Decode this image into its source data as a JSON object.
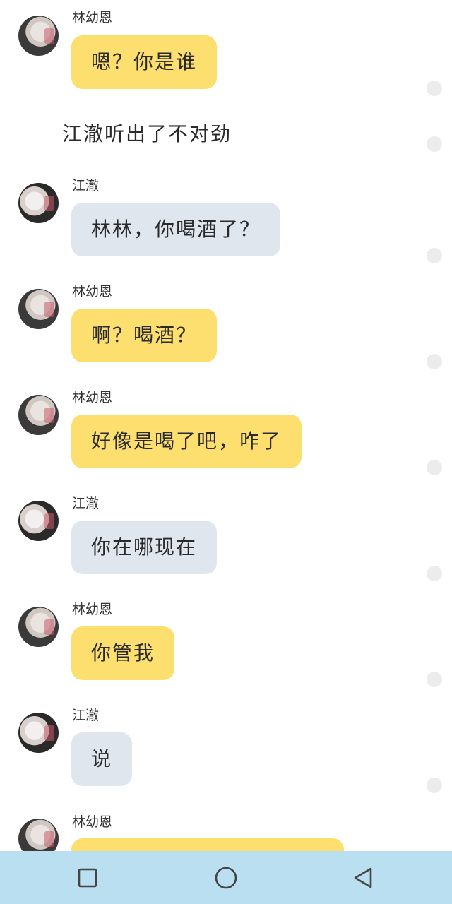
{
  "chat": {
    "narration": "江澈听出了不对劲",
    "messages": [
      {
        "sender": "林幼恩",
        "text": "嗯？你是谁",
        "style": "yellow"
      },
      {
        "sender": "江澈",
        "text": "林林，你喝酒了？",
        "style": "grey"
      },
      {
        "sender": "林幼恩",
        "text": "啊？喝酒？",
        "style": "yellow"
      },
      {
        "sender": "林幼恩",
        "text": "好像是喝了吧，咋了",
        "style": "yellow"
      },
      {
        "sender": "江澈",
        "text": "你在哪现在",
        "style": "grey"
      },
      {
        "sender": "林幼恩",
        "text": "你管我",
        "style": "yellow"
      },
      {
        "sender": "江澈",
        "text": "说",
        "style": "grey"
      },
      {
        "sender": "林幼恩",
        "text": "",
        "style": "yellow"
      }
    ]
  },
  "colors": {
    "yellow_bubble": "#fddf70",
    "grey_bubble": "#e0e6ee",
    "navbar": "#b9dff1"
  },
  "navbar": {
    "icons": [
      "recent-apps-icon",
      "home-icon",
      "back-icon"
    ]
  }
}
